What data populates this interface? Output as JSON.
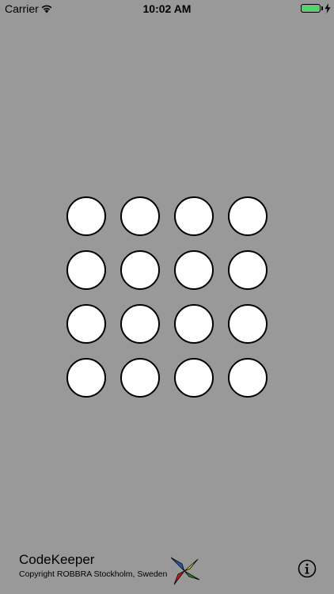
{
  "status_bar": {
    "carrier": "Carrier",
    "time": "10:02 AM",
    "battery_level": 1.0,
    "battery_color": "#4cd964",
    "wifi_icon": "wifi-icon",
    "charging_icon": "charging-bolt-icon"
  },
  "keypad": {
    "rows": 4,
    "columns": 4,
    "key_fill": "#ffffff",
    "key_stroke": "#000000"
  },
  "background_color": "#999999",
  "footer": {
    "app_name": "CodeKeeper",
    "copyright": "Copyright ROBBRA Stockholm, Sweden",
    "logo_icon": "robbra-logo-icon",
    "logo_colors": [
      "#1a5fb4",
      "#e8e31a",
      "#c01c28",
      "#2a8a3e"
    ],
    "info_icon": "info-icon"
  }
}
